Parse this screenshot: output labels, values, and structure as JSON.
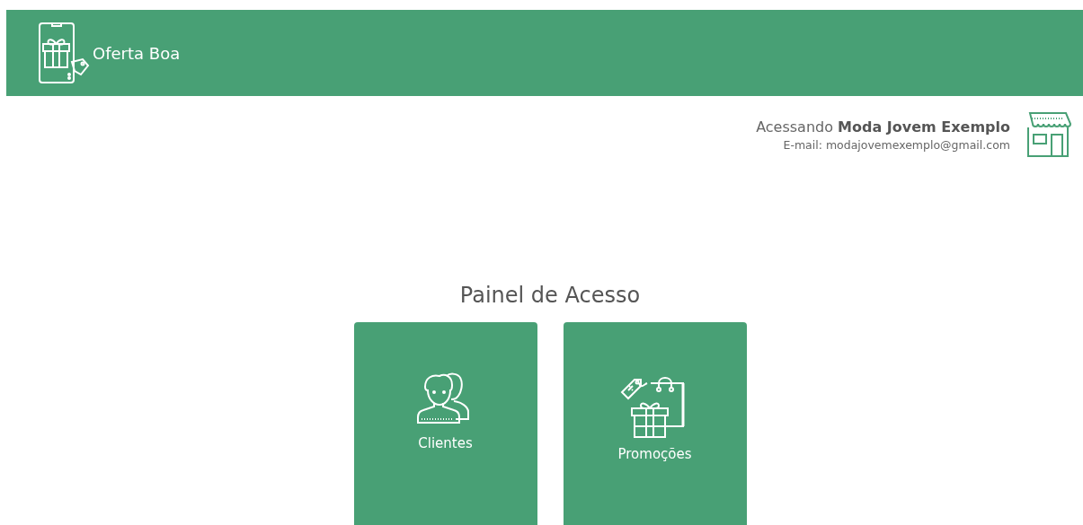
{
  "header": {
    "brand": "Oferta Boa"
  },
  "account": {
    "prefix": "Acessando",
    "store": "Moda Jovem Exemplo",
    "email": "E-mail: modajovemexemplo@gmail.com"
  },
  "panel": {
    "title": "Painel de Acesso",
    "cards": [
      {
        "label": "Clientes",
        "kind": "people"
      },
      {
        "label": "Promoções",
        "kind": "gifts"
      }
    ]
  }
}
